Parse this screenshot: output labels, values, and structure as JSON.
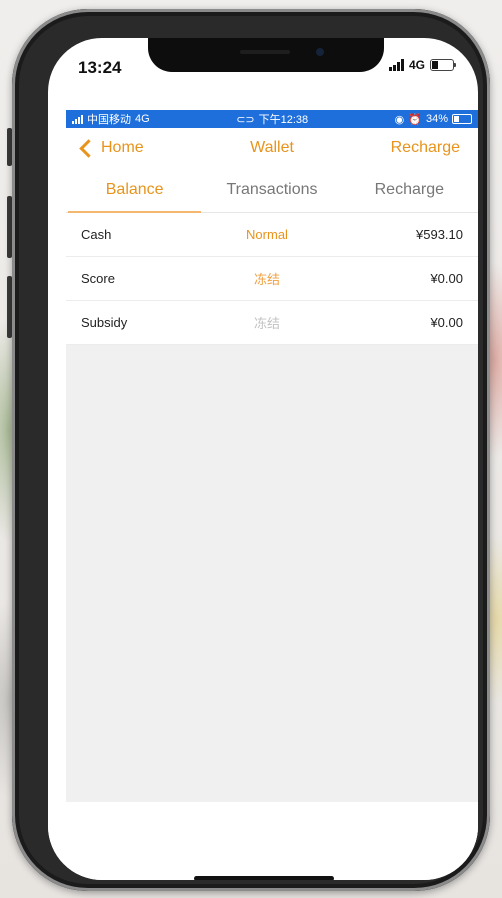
{
  "device": {
    "time": "13:24",
    "network": "4G"
  },
  "carrier_status": {
    "carrier": "中国移动",
    "network": "4G",
    "time": "下午12:38",
    "battery": "34%"
  },
  "nav": {
    "back_label": "Home",
    "title": "Wallet",
    "right_label": "Recharge"
  },
  "tabs": [
    {
      "label": "Balance",
      "active": true
    },
    {
      "label": "Transactions",
      "active": false
    },
    {
      "label": "Recharge",
      "active": false
    }
  ],
  "accounts": [
    {
      "name": "Cash",
      "state": "Normal",
      "amount": "¥593.10"
    },
    {
      "name": "Score",
      "state": "冻结",
      "amount": "¥0.00"
    },
    {
      "name": "Subsidy",
      "state": "冻结",
      "amount": "¥0.00"
    }
  ],
  "colors": {
    "accent": "#e8941c",
    "status_bar": "#1e6fdc",
    "frozen_gray": "#c2c2c2"
  }
}
